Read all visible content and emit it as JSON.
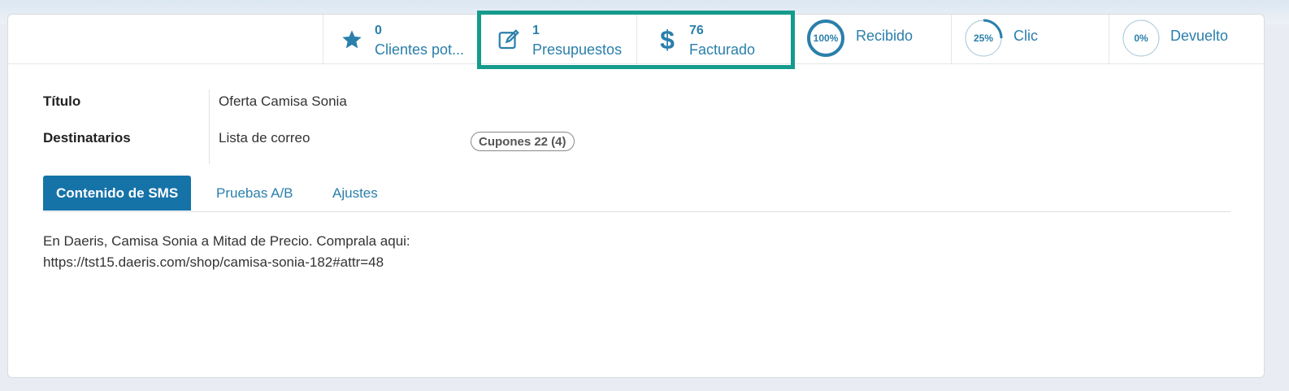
{
  "stats": {
    "leads": {
      "value": "0",
      "label": "Clientes pot..."
    },
    "quotes": {
      "value": "1",
      "label": "Presupuestos"
    },
    "invoiced": {
      "value": "76",
      "label": "Facturado"
    },
    "received": {
      "percent": "100%",
      "fraction": 1.0,
      "label": "Recibido"
    },
    "clicked": {
      "percent": "25%",
      "fraction": 0.25,
      "label": "Clic"
    },
    "bounced": {
      "percent": "0%",
      "fraction": 0.0,
      "label": "Devuelto"
    }
  },
  "form": {
    "title_label": "Título",
    "title_value": "Oferta Camisa Sonia",
    "recipients_label": "Destinatarios",
    "recipients_value": "Lista de correo",
    "recipients_tag": "Cupones 22 (4)"
  },
  "tabs": [
    {
      "label": "Contenido de SMS",
      "active": true
    },
    {
      "label": "Pruebas A/B",
      "active": false
    },
    {
      "label": "Ajustes",
      "active": false
    }
  ],
  "sms_content": {
    "line1": "En Daeris, Camisa Sonia a Mitad de Precio. Comprala aqui:",
    "line2": "https://tst15.daeris.com/shop/camisa-sonia-182#attr=48"
  },
  "colors": {
    "accent": "#2a7fab",
    "tab_active": "#1573a8",
    "highlight": "#149b8c"
  }
}
